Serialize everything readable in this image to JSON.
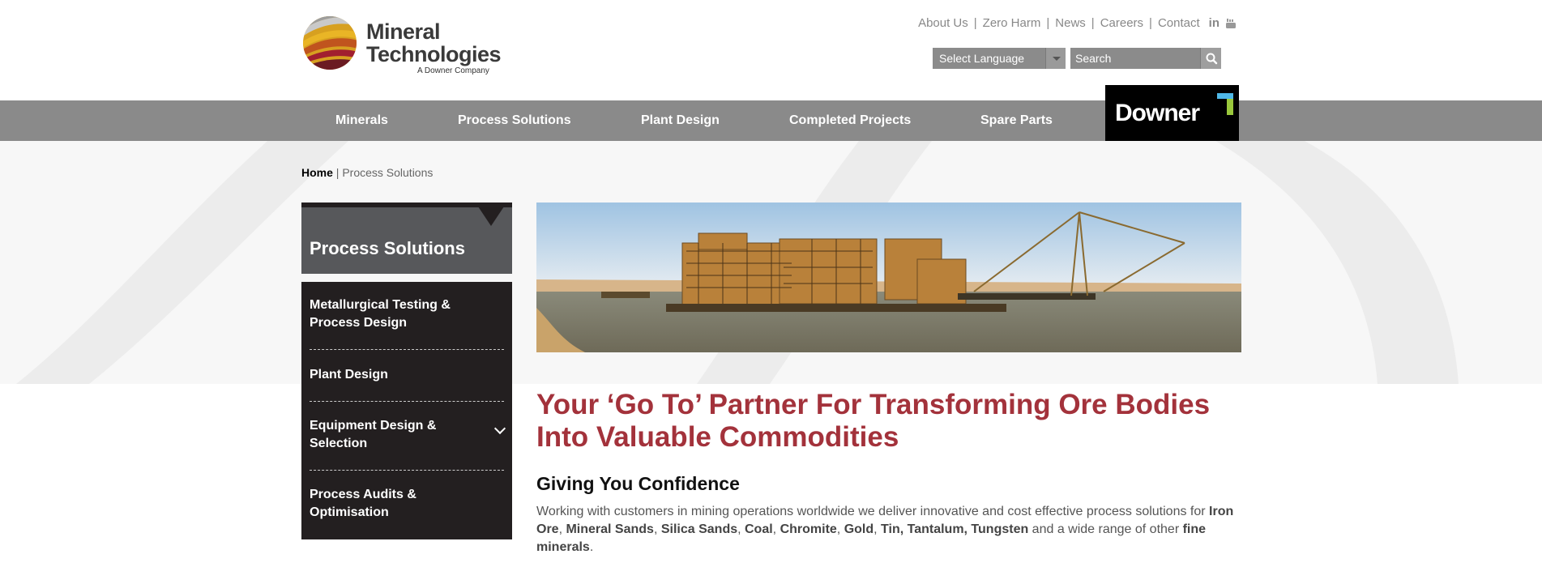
{
  "logo": {
    "line1": "Mineral",
    "line2": "Technologies",
    "sub": "A Downer Company"
  },
  "toplinks": [
    "About Us",
    "Zero Harm",
    "News",
    "Careers",
    "Contact"
  ],
  "social": {
    "linkedin": "in"
  },
  "language": {
    "value": "Select Language"
  },
  "search": {
    "placeholder": "Search"
  },
  "nav": [
    "Minerals",
    "Process Solutions",
    "Plant Design",
    "Completed Projects",
    "Spare Parts"
  ],
  "downer": {
    "label": "Downer"
  },
  "breadcrumb": {
    "home": "Home",
    "sep": " | ",
    "current": "Process Solutions"
  },
  "sidebar": {
    "title": "Process Solutions",
    "items": [
      {
        "line1": "Metallurgical Testing &",
        "line2": "Process Design"
      },
      {
        "line1": "Plant Design",
        "line2": ""
      },
      {
        "line1": "Equipment Design &",
        "line2": "Selection"
      },
      {
        "line1": "Process Audits &",
        "line2": "Optimisation"
      }
    ]
  },
  "main": {
    "heading_line1": "Your ‘Go To’ Partner For Transforming Ore Bodies",
    "heading_line2": "Into Valuable Commodities",
    "subheading": "Giving You Confidence",
    "para": {
      "t1": "Working with customers in mining operations worldwide we deliver innovative and cost effective process solutions for ",
      "b1": "Iron Ore",
      "t2": ", ",
      "b2": "Mineral Sands",
      "t3": ", ",
      "b3": "Silica Sands",
      "t4": ", ",
      "b4": "Coal",
      "t5": ", ",
      "b5": "Chromite",
      "t6": ", ",
      "b6": "Gold",
      "t7": ", ",
      "b7": "Tin, Tantalum, Tungsten",
      "t8": " and a wide range of other ",
      "b8": "fine minerals",
      "t9": "."
    }
  },
  "colors": {
    "nav_bg": "#8a8a8a",
    "heading_red": "#a3323b",
    "sidebar_dark": "#231f20",
    "sidebar_head": "#57585b"
  }
}
